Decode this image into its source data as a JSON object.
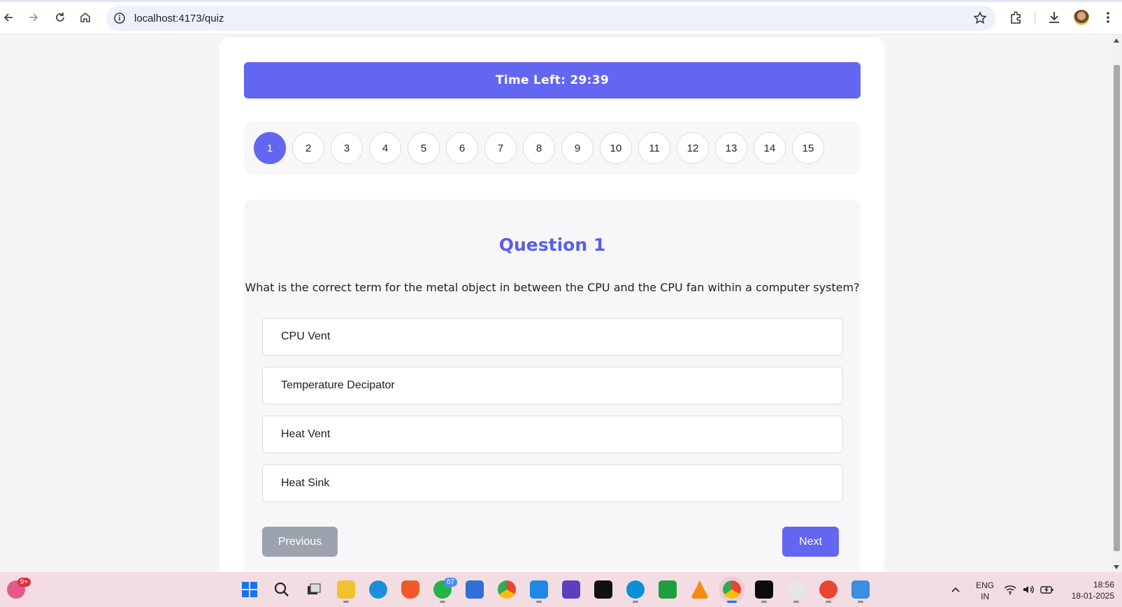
{
  "browser": {
    "url": "localhost:4173/quiz"
  },
  "quiz": {
    "timer_label": "Time Left: 29:39",
    "question_numbers": [
      "1",
      "2",
      "3",
      "4",
      "5",
      "6",
      "7",
      "8",
      "9",
      "10",
      "11",
      "12",
      "13",
      "14",
      "15"
    ],
    "active_question": "1",
    "question_title": "Question 1",
    "question_text": "What is the correct term for the metal object in between the CPU and the CPU fan within a computer system?",
    "options": [
      "CPU Vent",
      "Temperature Decipator",
      "Heat Vent",
      "Heat Sink"
    ],
    "previous_label": "Previous",
    "next_label": "Next",
    "accent_color": "#6366f1"
  },
  "taskbar": {
    "notification_badge": "9+",
    "whatsapp_badge": "67",
    "language_line1": "ENG",
    "language_line2": "IN",
    "time": "18:56",
    "date": "18-01-2025"
  }
}
